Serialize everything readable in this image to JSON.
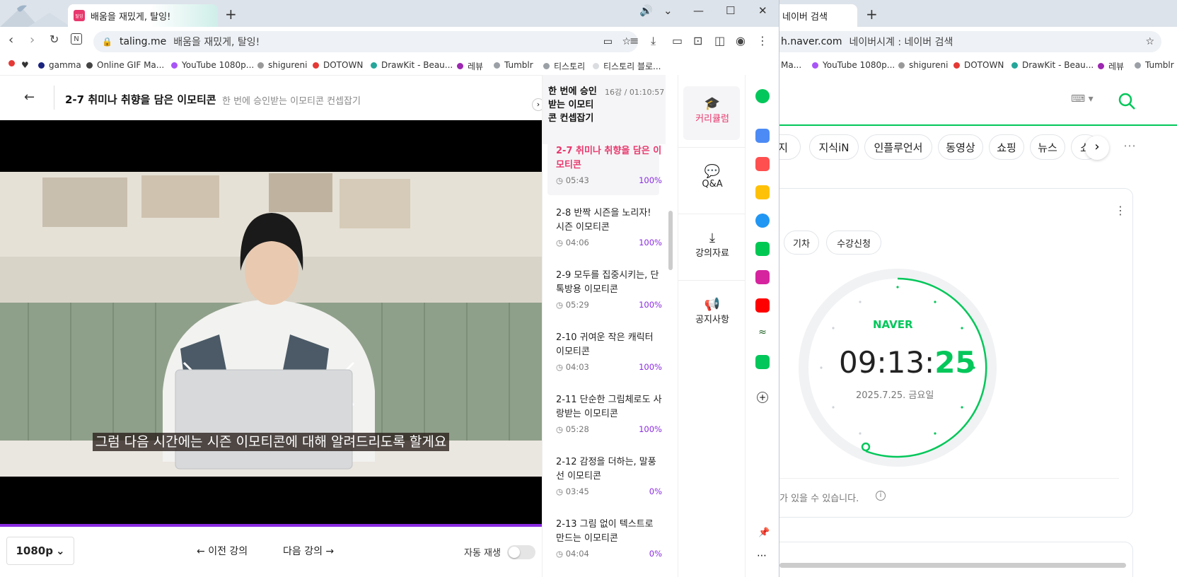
{
  "left_window": {
    "tab": {
      "title": "배움을 재밌게, 탈잉!",
      "favicon": "탈잉"
    },
    "new_tab": "+",
    "address": {
      "host": "taling.me",
      "title": "배움을 재밌게, 탈잉!"
    },
    "bookmarks": [
      {
        "label": "",
        "color": "#e53935"
      },
      {
        "label": "♥",
        "color": "#111"
      },
      {
        "label": "gamma",
        "color": "#1a237e"
      },
      {
        "label": "Online GIF Ma...",
        "color": "#444"
      },
      {
        "label": "YouTube 1080p...",
        "color": "#a855f7"
      },
      {
        "label": "shigureni",
        "color": "#999"
      },
      {
        "label": "DOTOWN",
        "color": "#e53935"
      },
      {
        "label": "DrawKit - Beau...",
        "color": "#26a69a"
      },
      {
        "label": "레뷰",
        "color": "#9c27b0"
      },
      {
        "label": "Tumblr",
        "color": "#9aa0a6"
      },
      {
        "label": "티스토리",
        "color": "#9aa0a6"
      },
      {
        "label": "티스토리 블로...",
        "color": "#dadce0"
      }
    ],
    "header": {
      "lesson_title": "2-7 취미나 취향을 담은 이모티콘",
      "course_title": "한 번에 승인받는 이모티콘 컨셉잡기"
    },
    "subtitle": "그럼 다음 시간에는 시즌 이모티콘에 대해 알려드리도록 할게요",
    "controls": {
      "quality": "1080p",
      "prev": "이전 강의",
      "next": "다음 강의",
      "autoplay": "자동 재생"
    },
    "playlist": {
      "title": "한 번에 승인받는 이모티콘 컨셉잡기",
      "meta": "16강 / 01:10:57",
      "items": [
        {
          "title": "2-7 취미나 취향을 담은 이모티콘",
          "time": "05:43",
          "progress": "100%",
          "active": true
        },
        {
          "title": "2-8 반짝 시즌을 노리자! 시즌 이모티콘",
          "time": "04:06",
          "progress": "100%"
        },
        {
          "title": "2-9 모두를 집중시키는, 단톡방용 이모티콘",
          "time": "05:29",
          "progress": "100%"
        },
        {
          "title": "2-10 귀여운 작은 캐릭터 이모티콘",
          "time": "04:03",
          "progress": "100%"
        },
        {
          "title": "2-11 단순한 그림체로도 사랑받는 이모티콘",
          "time": "05:28",
          "progress": "100%"
        },
        {
          "title": "2-12 감정을 더하는, 말풍선 이모티콘",
          "time": "03:45",
          "progress": "0%"
        },
        {
          "title": "2-13 그림 없이 텍스트로 만드는 이모티콘",
          "time": "04:04",
          "progress": "0%"
        }
      ]
    },
    "side_menu": [
      {
        "label": "커리큘럼",
        "icon": "graduation-cap-icon"
      },
      {
        "label": "Q&A",
        "icon": "chat-bubble-icon"
      },
      {
        "label": "강의자료",
        "icon": "download-icon"
      },
      {
        "label": "공지사항",
        "icon": "megaphone-icon"
      }
    ]
  },
  "right_window": {
    "tab": {
      "title": "네이버 검색"
    },
    "new_tab": "+",
    "address": {
      "host": "h.naver.com",
      "title": "네이버시계 : 네이버 검색"
    },
    "bookmarks": [
      {
        "label": "Ma...",
        "color": "#444"
      },
      {
        "label": "YouTube 1080p...",
        "color": "#a855f7"
      },
      {
        "label": "shigureni",
        "color": "#999"
      },
      {
        "label": "DOTOWN",
        "color": "#e53935"
      },
      {
        "label": "DrawKit - Beau...",
        "color": "#26a69a"
      },
      {
        "label": "레뷰",
        "color": "#9c27b0"
      },
      {
        "label": "Tumblr",
        "color": "#9aa0a6"
      }
    ],
    "search_tabs": [
      "지",
      "지식iN",
      "인플루언서",
      "동영상",
      "쇼핑",
      "뉴스",
      "쇼"
    ],
    "chips": [
      "기차",
      "수강신청"
    ],
    "clock": {
      "brand": "NAVER",
      "hm": "09:13:",
      "sec": "25",
      "date": "2025.7.25. 금요일"
    },
    "notice": "가 있을 수 있습니다."
  },
  "colors": {
    "accent_pink": "#e8386d",
    "naver_green": "#03c75a",
    "purple": "#8a2be2"
  }
}
